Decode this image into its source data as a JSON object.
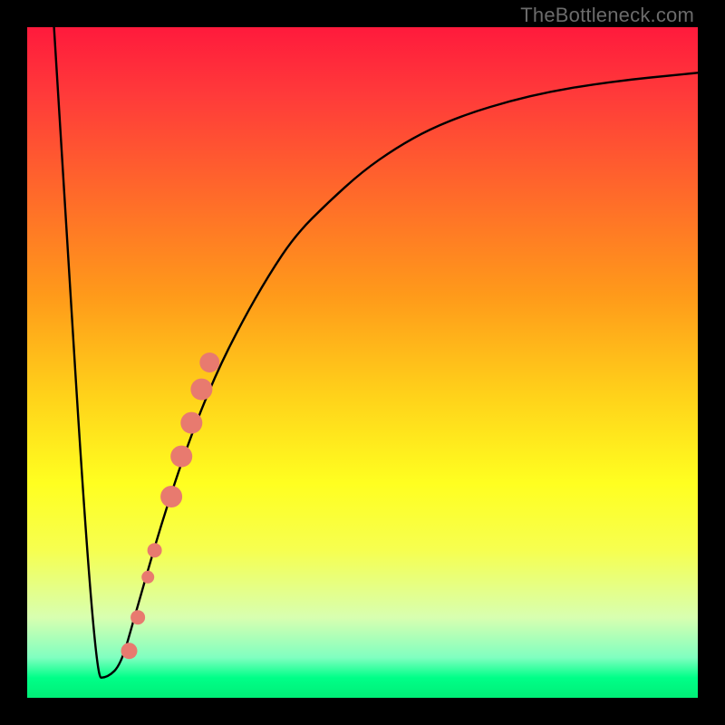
{
  "watermark": "TheBottleneck.com",
  "chart_data": {
    "type": "line",
    "title": "",
    "xlabel": "",
    "ylabel": "",
    "xlim": [
      0,
      100
    ],
    "ylim": [
      0,
      100
    ],
    "series": [
      {
        "name": "bottleneck-curve",
        "x": [
          4,
          10,
          12,
          14,
          16,
          20,
          24,
          28,
          32,
          36,
          40,
          45,
          50,
          55,
          60,
          66,
          72,
          78,
          84,
          90,
          96,
          100
        ],
        "y": [
          100,
          3,
          3,
          5,
          12,
          26,
          38,
          48,
          56,
          63,
          69,
          74,
          78.5,
          82,
          84.8,
          87.2,
          89,
          90.4,
          91.4,
          92.2,
          92.8,
          93.2
        ]
      }
    ],
    "highlight_points": {
      "name": "marker-cluster",
      "color": "#e87a6f",
      "points": [
        {
          "x": 15.2,
          "y": 7,
          "r": 9
        },
        {
          "x": 16.5,
          "y": 12,
          "r": 8
        },
        {
          "x": 18.0,
          "y": 18,
          "r": 7
        },
        {
          "x": 19.0,
          "y": 22,
          "r": 8
        },
        {
          "x": 21.5,
          "y": 30,
          "r": 12
        },
        {
          "x": 23.0,
          "y": 36,
          "r": 12
        },
        {
          "x": 24.5,
          "y": 41,
          "r": 12
        },
        {
          "x": 26.0,
          "y": 46,
          "r": 12
        },
        {
          "x": 27.2,
          "y": 50,
          "r": 11
        }
      ]
    },
    "gradient_stops": [
      {
        "pos": 0,
        "color": "#ff1a3c"
      },
      {
        "pos": 25,
        "color": "#ff6a2a"
      },
      {
        "pos": 55,
        "color": "#ffd21a"
      },
      {
        "pos": 78,
        "color": "#f6ff50"
      },
      {
        "pos": 97,
        "color": "#00ff88"
      },
      {
        "pos": 100,
        "color": "#00ee77"
      }
    ]
  }
}
